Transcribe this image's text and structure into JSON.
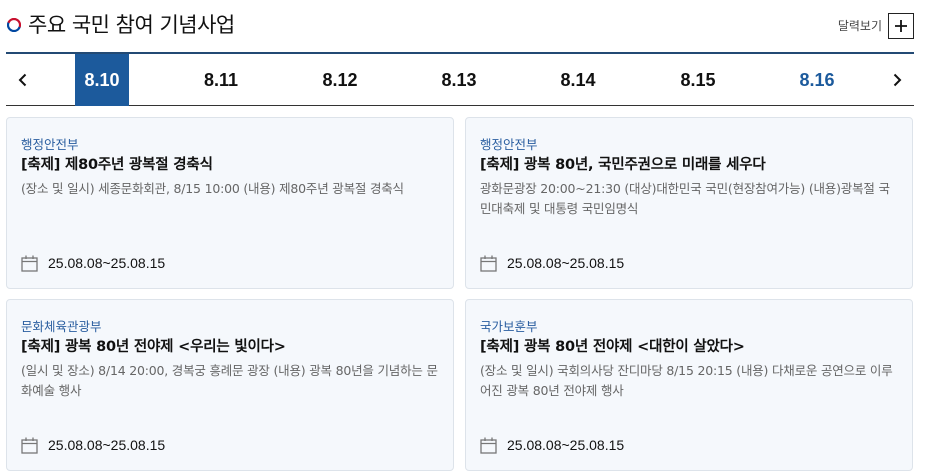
{
  "header": {
    "title": "주요 국민 참여 기념사업",
    "calendar_label": "달력보기"
  },
  "tabs": {
    "dates": [
      "8.10",
      "8.11",
      "8.12",
      "8.13",
      "8.14",
      "8.15",
      "8.16"
    ],
    "active_index": 0
  },
  "cards": [
    {
      "org": "행정안전부",
      "title": "[축제] 제80주년 광복절 경축식",
      "desc": "(장소 및 일시) 세종문화회관, 8/15 10:00 (내용) 제80주년 광복절 경축식",
      "period": "25.08.08~25.08.15"
    },
    {
      "org": "행정안전부",
      "title": "[축제] 광복 80년, 국민주권으로 미래를 세우다",
      "desc": "광화문광장 20:00~21:30 (대상)대한민국 국민(현장참여가능) (내용)광복절 국민대축제 및 대통령 국민임명식",
      "period": "25.08.08~25.08.15"
    },
    {
      "org": "문화체육관광부",
      "title": "[축제] 광복 80년 전야제 <우리는 빛이다>",
      "desc": "(일시 및 장소) 8/14 20:00, 경복궁 흥례문 광장 (내용) 광복 80년을 기념하는 문화예술 행사",
      "period": "25.08.08~25.08.15"
    },
    {
      "org": "국가보훈부",
      "title": "[축제] 광복 80년 전야제 <대한이 살았다>",
      "desc": "(장소 및 일시) 국회의사당 잔디마당 8/15 20:15 (내용) 다채로운 공연으로 이루어진 광복 80년 전야제 행사",
      "period": "25.08.08~25.08.15"
    }
  ],
  "colors": {
    "accent": "#1c5a9c",
    "org_text": "#2a5ea0",
    "card_bg": "#f5f8fc"
  }
}
